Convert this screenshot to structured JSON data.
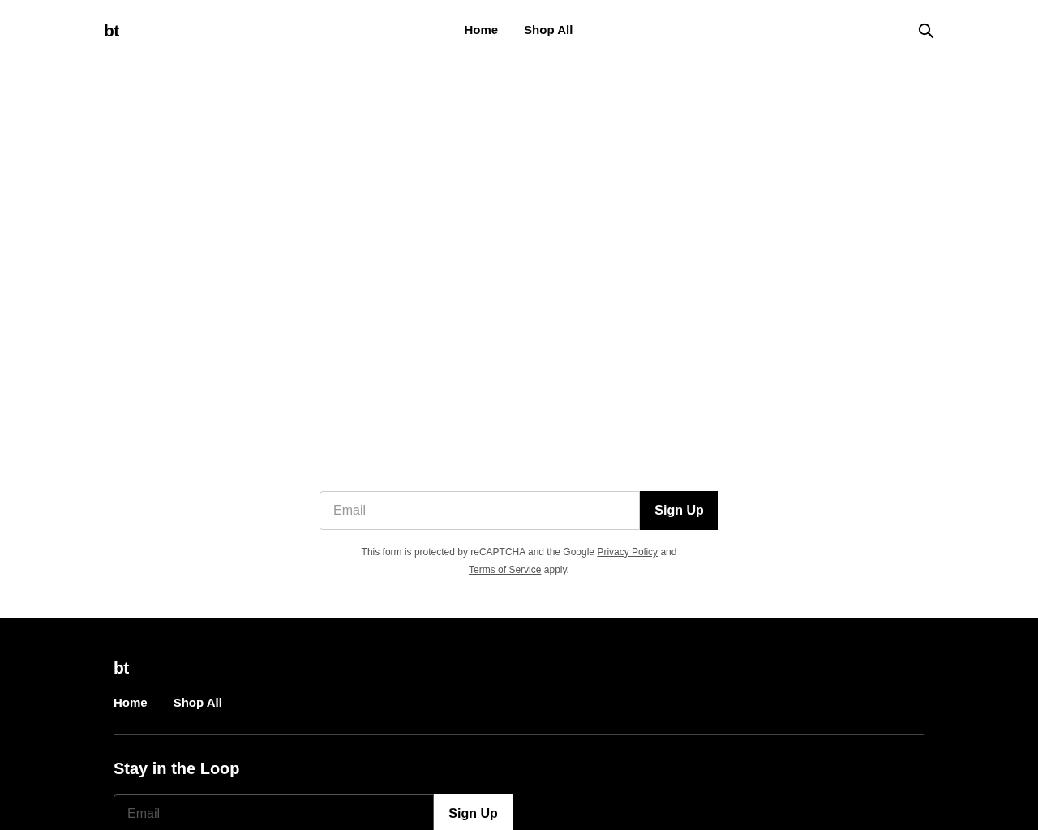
{
  "header": {
    "logo": "bt",
    "nav": [
      {
        "label": "Home"
      },
      {
        "label": "Shop All"
      }
    ]
  },
  "signup": {
    "placeholder": "Email",
    "button": "Sign Up",
    "notice": [
      {
        "kind": "text",
        "text": "This form is protected by reCAPTCHA and the Google"
      },
      {
        "kind": "link",
        "text": "Privacy Policy"
      },
      {
        "kind": "text",
        "text": "and"
      },
      {
        "kind": "link",
        "text": "Terms of Service"
      },
      {
        "kind": "text",
        "text": "apply."
      }
    ]
  },
  "footer": {
    "logo": "bt",
    "nav": [
      {
        "label": "Home"
      },
      {
        "label": "Shop All"
      }
    ],
    "heading": "Stay in the Loop",
    "placeholder": "Email",
    "button": "Sign Up"
  }
}
